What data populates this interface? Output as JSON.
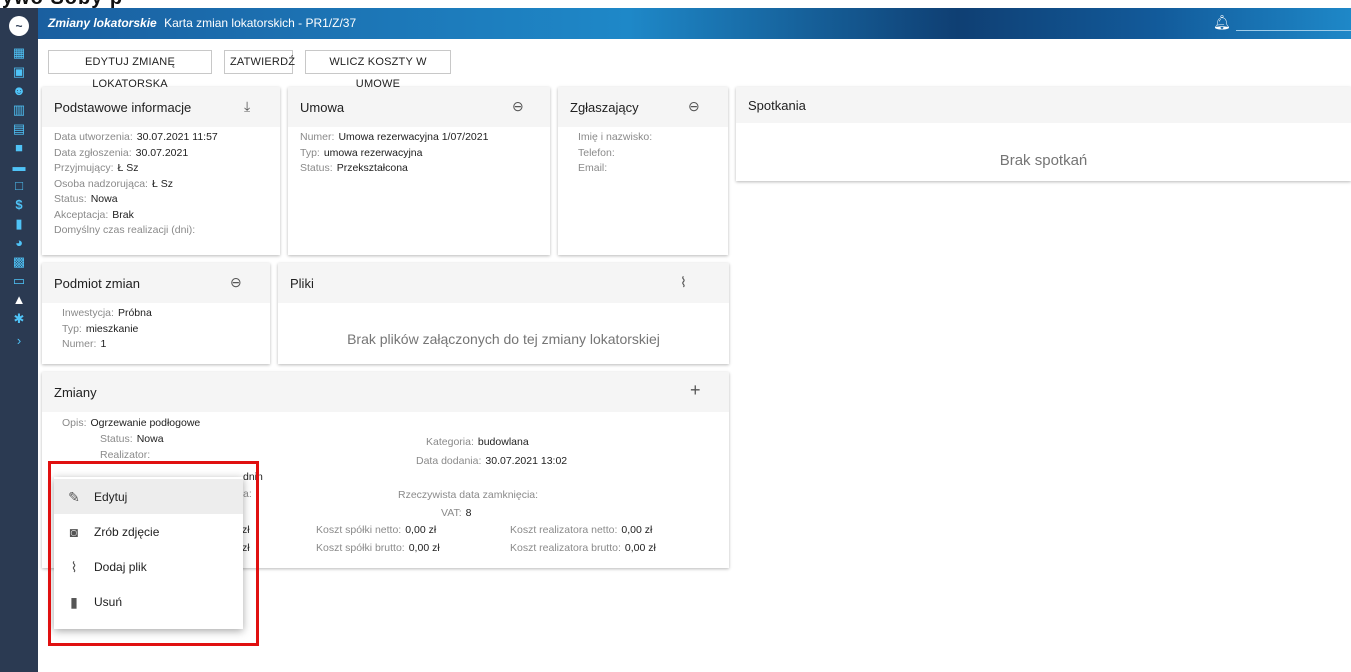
{
  "banner": {
    "text": "ywo  Soby p"
  },
  "topbar": {
    "module": "Zmiany lokatorskie",
    "title": "Karta zmian lokatorskich - PR1/Z/37"
  },
  "toolbar": {
    "edit_label": "EDYTUJ ZMIANĘ LOKATORSKĄ",
    "approve_label": "ZATWIERDŹ",
    "include_costs_label": "WLICZ KOSZTY W UMOWĘ"
  },
  "basic": {
    "title": "Podstawowe informacje",
    "rows": [
      {
        "label": "Data utworzenia:",
        "value": "30.07.2021 11:57"
      },
      {
        "label": "Data zgłoszenia:",
        "value": "30.07.2021"
      },
      {
        "label": "Przyjmujący:",
        "value": "Ł Sz"
      },
      {
        "label": "Osoba nadzorująca:",
        "value": "Ł Sz"
      },
      {
        "label": "Status:",
        "value": "Nowa"
      },
      {
        "label": "Akceptacja:",
        "value": "Brak"
      },
      {
        "label": "Domyślny czas realizacji (dni):",
        "value": ""
      }
    ]
  },
  "contract": {
    "title": "Umowa",
    "rows": [
      {
        "label": "Numer:",
        "value": "Umowa rezerwacyjna 1/07/2021"
      },
      {
        "label": "Typ:",
        "value": "umowa rezerwacyjna"
      },
      {
        "label": "Status:",
        "value": "Przekształcona"
      }
    ]
  },
  "reporter": {
    "title": "Zgłaszający",
    "rows": [
      {
        "label": "Imię i nazwisko:",
        "value": ""
      },
      {
        "label": "Telefon:",
        "value": ""
      },
      {
        "label": "Email:",
        "value": ""
      }
    ]
  },
  "meetings": {
    "title": "Spotkania",
    "empty": "Brak spotkań"
  },
  "subject": {
    "title": "Podmiot zmian",
    "rows": [
      {
        "label": "Inwestycja:",
        "value": "Próbna"
      },
      {
        "label": "Typ:",
        "value": "mieszkanie"
      },
      {
        "label": "Numer:",
        "value": "1"
      }
    ]
  },
  "files": {
    "title": "Pliki",
    "empty": "Brak plików załączonych do tej zmiany lokatorskiej"
  },
  "changes": {
    "title": "Zmiany",
    "description_label": "Opis:",
    "description_value": "Ogrzewanie podłogowe",
    "status_label": "Status:",
    "status_value": "Nowa",
    "realizer_label": "Realizator:",
    "partial_dnin": "dnin",
    "partial_a": "a:",
    "partial_zl1": "zł",
    "partial_zl2": "zł",
    "category_label": "Kategoria:",
    "category_value": "budowlana",
    "date_added_label": "Data dodania:",
    "date_added_value": "30.07.2021 13:02",
    "actual_close_label": "Rzeczywista data zamknięcia:",
    "vat_label": "VAT:",
    "vat_value": "8",
    "company_net_label": "Koszt spółki netto:",
    "company_net_value": "0,00 zł",
    "company_gross_label": "Koszt spółki brutto:",
    "company_gross_value": "0,00 zł",
    "realizer_net_label": "Koszt realizatora netto:",
    "realizer_net_value": "0,00 zł",
    "realizer_gross_label": "Koszt realizatora brutto:",
    "realizer_gross_value": "0,00 zł"
  },
  "context_menu": {
    "items": [
      {
        "label": "Edytuj",
        "icon": "pencil-icon"
      },
      {
        "label": "Zrób zdjęcie",
        "icon": "camera-icon"
      },
      {
        "label": "Dodaj plik",
        "icon": "paperclip-icon"
      },
      {
        "label": "Usuń",
        "icon": "trash-icon"
      }
    ]
  },
  "colors": {
    "sidebar": "#2b3a52",
    "accent": "#4fc3f7",
    "highlight": "#e01010"
  }
}
